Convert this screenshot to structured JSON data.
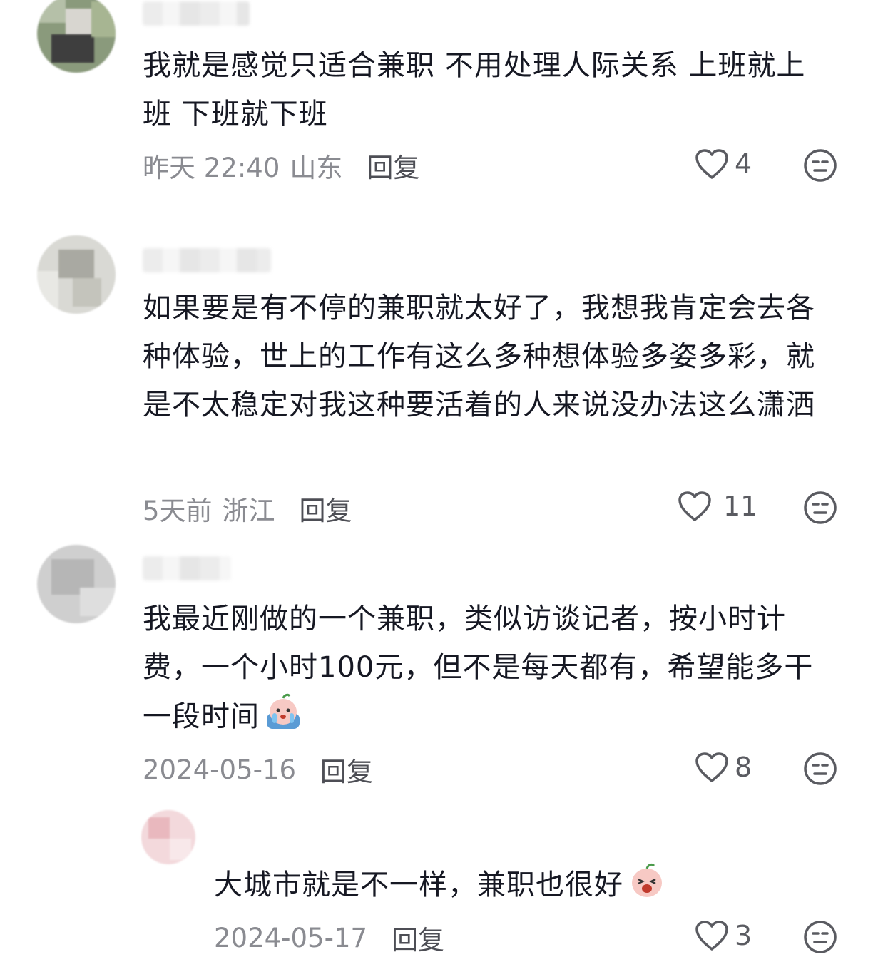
{
  "comments": [
    {
      "text": "我就是感觉只适合兼职 不用处理人际关系 上班就上班 下班就下班",
      "time": "昨天 22:40",
      "location": "山东",
      "reply_label": "回复",
      "likes": "4"
    },
    {
      "text": "如果要是有不停的兼职就太好了，我想我肯定会去各种体验，世上的工作有这么多种想体验多姿多彩，就是不太稳定对我这种要活着的人来说没办法这么潇洒",
      "time": "5天前",
      "location": "浙江",
      "reply_label": "回复",
      "likes": "11"
    },
    {
      "text": "我最近刚做的一个兼职，类似访谈记者，按小时计费，一个小时100元，但不是每天都有，希望能多干一段时间",
      "time": "2024-05-16",
      "location": "",
      "reply_label": "回复",
      "likes": "8",
      "emoji": "crying-peach-emoji"
    },
    {
      "text": "大城市就是不一样，兼职也很好",
      "time": "2024-05-17",
      "location": "",
      "reply_label": "回复",
      "likes": "3",
      "emoji": "shocked-peach-emoji"
    }
  ],
  "icons": {
    "like": "heart-outline-icon",
    "dislike": "neutral-face-icon"
  },
  "colors": {
    "text": "#161823",
    "meta": "#8a8b91",
    "reply": "#4d4e55",
    "icon": "#5a5b61"
  }
}
